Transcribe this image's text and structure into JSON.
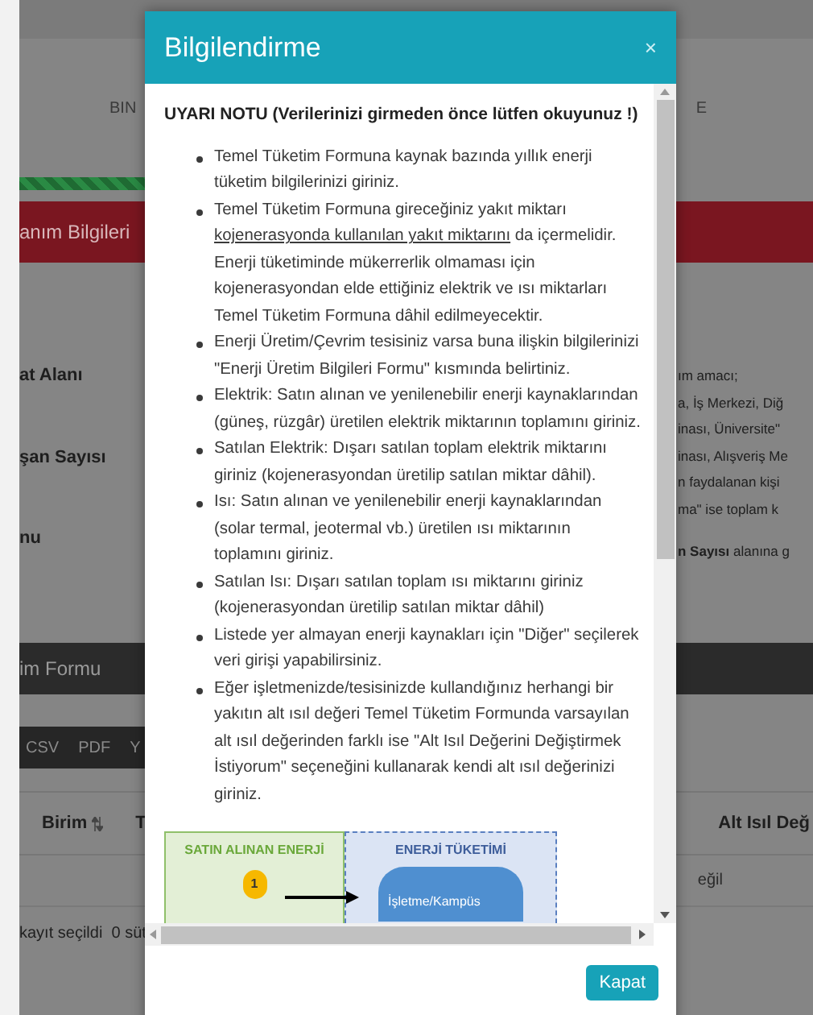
{
  "background": {
    "stepper": {
      "left_label": "BIN",
      "right_label": "E"
    },
    "progress": {
      "level": 1
    },
    "section_bar": "anım Bilgileri",
    "form_labels": [
      "at Alanı",
      "şan Sayısı",
      "nu"
    ],
    "side_note": [
      "ım amacı;",
      "a, İş Merkezi, Diğ",
      "inası, Üniversite\"",
      "inası, Alışveriş Me",
      "n faydalanan kişi",
      "ma\" ise toplam k",
      "**n Sayısı** alanına g"
    ],
    "form_bar": "im Formu",
    "export_buttons": [
      "CSV",
      "PDF",
      "Y"
    ],
    "table": {
      "columns": [
        "Birim",
        "T",
        "Alt Isıl Değ"
      ],
      "rows": [
        [
          "eğil"
        ]
      ]
    },
    "status": "kayıt seçildi  0 süt"
  },
  "modal": {
    "title": "Bilgilendirme",
    "close": "×",
    "heading": "UYARI NOTU (Verilerinizi girmeden önce lütfen okuyunuz !)",
    "bullets": [
      [
        {
          "text": "Temel Tüketim Formuna kaynak bazında yıllık enerji tüketim bilgilerinizi giriniz.",
          "underline": false
        }
      ],
      [
        {
          "text": "Temel Tüketim Formuna gireceğiniz yakıt miktarı ",
          "underline": false
        },
        {
          "text": "kojenerasyonda kullanılan yakıt miktarını",
          "underline": true
        },
        {
          "text": " da içermelidir. Enerji tüketiminde mükerrerlik olmaması için kojenerasyondan elde ettiğiniz elektrik ve ısı miktarları Temel Tüketim Formuna dâhil edilmeyecektir.",
          "underline": false
        }
      ],
      [
        {
          "text": "Enerji Üretim/Çevrim tesisiniz varsa buna ilişkin bilgilerinizi \"Enerji Üretim Bilgileri Formu\" kısmında belirtiniz.",
          "underline": false
        }
      ],
      [
        {
          "text": "Elektrik: Satın alınan ve yenilenebilir enerji kaynaklarından (güneş, rüzgâr) üretilen elektrik miktarının toplamını giriniz.",
          "underline": false
        }
      ],
      [
        {
          "text": "Satılan Elektrik: Dışarı satılan toplam elektrik miktarını giriniz (kojenerasyondan üretilip satılan miktar dâhil).",
          "underline": false
        }
      ],
      [
        {
          "text": "Isı: Satın alınan ve yenilenebilir enerji kaynaklarından (solar termal, jeotermal vb.) üretilen ısı miktarının toplamını giriniz.",
          "underline": false
        }
      ],
      [
        {
          "text": "Satılan Isı: Dışarı satılan toplam ısı miktarını giriniz (kojenerasyondan üretilip satılan miktar dâhil)",
          "underline": false
        }
      ],
      [
        {
          "text": "Listede yer almayan enerji kaynakları için \"Diğer\" seçilerek veri girişi yapabilirsiniz.",
          "underline": false
        }
      ],
      [
        {
          "text": "Eğer işletmenizde/tesisinizde kullandığınız herhangi bir yakıtın alt ısıl değeri Temel Tüketim Formunda varsayılan alt ısıl değerinden farklı ise \"Alt Isıl Değerini Değiştirmek İstiyorum\" seçeneğini kullanarak kendi alt ısıl değerinizi giriniz.",
          "underline": false
        }
      ]
    ],
    "diagram": {
      "left_title": "SATIN ALINAN ENERJİ",
      "step": "1",
      "right_title": "ENERJİ TÜKETİMİ",
      "node": "İşletme/Kampüs"
    },
    "button": "Kapat"
  }
}
